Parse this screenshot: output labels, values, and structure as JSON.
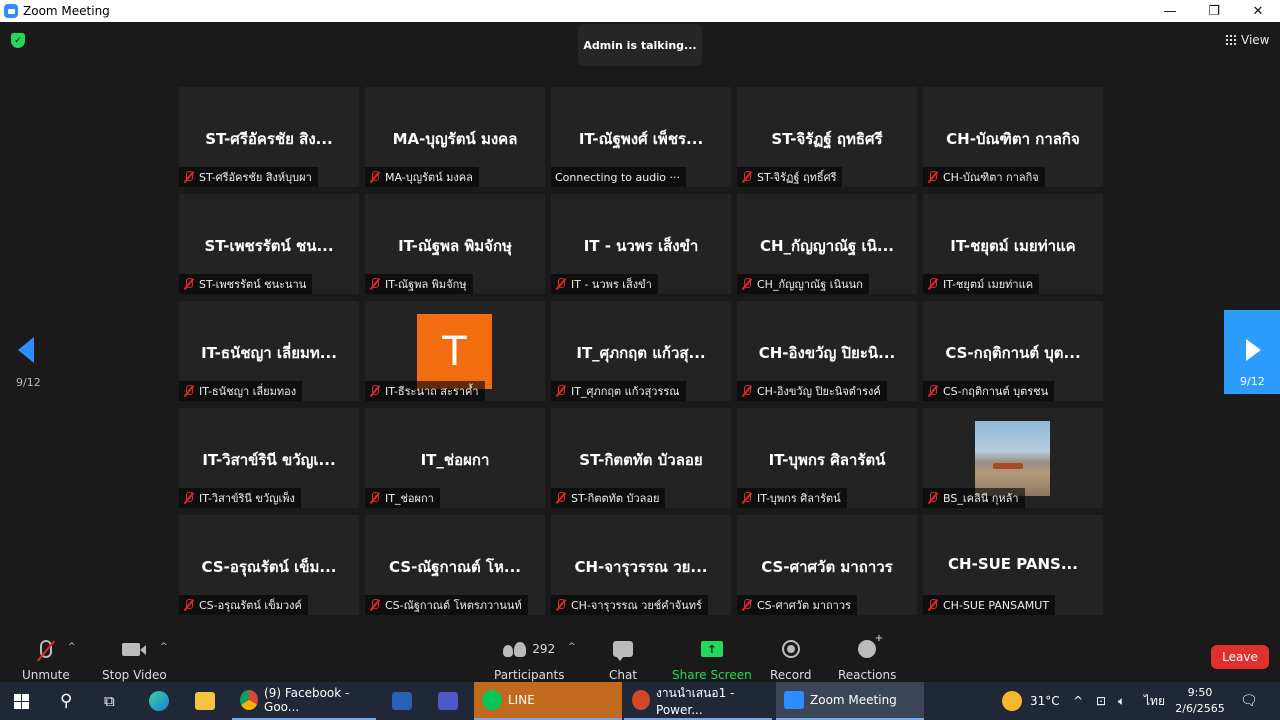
{
  "window": {
    "title": "Zoom Meeting",
    "controls": {
      "minimize": "—",
      "restore": "❐",
      "close": "✕"
    }
  },
  "meeting": {
    "talking_indicator": "Admin is talking...",
    "view_label": "View",
    "page_left": "9/12",
    "page_right": "9/12"
  },
  "tiles": [
    {
      "big": "ST-ศรีอัครชัย สิง...",
      "label": "ST-ศรีอัครชัย สิงห์บุบผา",
      "muted": true
    },
    {
      "big": "MA-บุญรัตน์ มงคล",
      "label": "MA-บุญรัตน์ มงคล",
      "muted": true
    },
    {
      "big": "IT-ณัฐพงศ์ เพ็ชร...",
      "label": "Connecting to audio ···",
      "muted": false
    },
    {
      "big": "ST-จิรัฏฐ์ ฤทธิศรี",
      "label": "ST-จิรัฏฐ์ ฤทธิ์ศรี",
      "muted": true
    },
    {
      "big": "CH-บัณฑิตา กาลกิจ",
      "label": "CH-บัณฑิตา กาลกิจ",
      "muted": true
    },
    {
      "big": "ST-เพชรรัตน์ ชน...",
      "label": "ST-เพชรรัตน์ ชนะนาน",
      "muted": true
    },
    {
      "big": "IT-ณัฐพล พิมจักษุ",
      "label": "IT-ณัฐพล พิมจักษุ",
      "muted": true
    },
    {
      "big": "IT - นวพร เส็งขำ",
      "label": "IT - นวพร เส็งขำ",
      "muted": true
    },
    {
      "big": "CH_กัญญาณัฐ เนิ...",
      "label": "CH_กัญญาณัฐ เนินนก",
      "muted": true
    },
    {
      "big": "IT-ชยุตม์ เมยท่าแค",
      "label": "IT-ชยุตม์ เมยท่าแค",
      "muted": true
    },
    {
      "big": "IT-ธนัชญา เลี่ยมท...",
      "label": "IT-ธนัชญา เลี่ยมทอง",
      "muted": true
    },
    {
      "big": "",
      "avatar": "T",
      "label": "IT-ธีระนาถ สะราค้ำ",
      "muted": true
    },
    {
      "big": "IT_ศุภกฤต แก้วสุ...",
      "label": "IT_ศุภกฤต แก้วสุวรรณ",
      "muted": true
    },
    {
      "big": "CH-อิงขวัญ ปิยะนิ...",
      "label": "CH-อิงขวัญ ปิยะนิจตำรงค์",
      "muted": true
    },
    {
      "big": "CS-กฤติกานต์ บุต...",
      "label": "CS-กฤติกานต์ บุตรชน",
      "muted": true
    },
    {
      "big": "IT-วิสาข์รินี ขวัญเ...",
      "label": "IT-วิสาข์รินี ขวัญเพ็ง",
      "muted": true
    },
    {
      "big": "IT_ช่อผกา",
      "label": "IT_ช่อผกา",
      "muted": true
    },
    {
      "big": "ST-กิตตทัต บัวลอย",
      "label": "ST-กิตตทัต บัวลอย",
      "muted": true
    },
    {
      "big": "IT-บุพกร ศิลารัตน์",
      "label": "IT-บุพกร ศิลารัตน์",
      "muted": true
    },
    {
      "big": "",
      "photo": true,
      "label": "BS_เคลินี กุหล้า",
      "muted": true
    },
    {
      "big": "CS-อรุณรัตน์ เข็ม...",
      "label": "CS-อรุณรัตน์ เข็มวงค์",
      "muted": true
    },
    {
      "big": "CS-ณัฐกาณต์ โห...",
      "label": "CS-ณัฐกาณต์ โหตรภวานนท์",
      "muted": true
    },
    {
      "big": "CH-จารุวรรณ วย...",
      "label": "CH-จารุวรรณ วยช์คำจันทร์",
      "muted": true
    },
    {
      "big": "CS-ศาศวัต มาถาวร",
      "label": "CS-ศาศวัต มาถาวร",
      "muted": true
    },
    {
      "big": "CH-SUE    PANS...",
      "label": "CH-SUE    PANSAMUT",
      "muted": true
    }
  ],
  "toolbar": {
    "unmute": "Unmute",
    "stop_video": "Stop Video",
    "participants_count": "292",
    "participants": "Participants",
    "chat": "Chat",
    "share_screen": "Share Screen",
    "record": "Record",
    "reactions": "Reactions",
    "leave": "Leave"
  },
  "taskbar": {
    "chrome": "(9) Facebook - Goo...",
    "line": "LINE",
    "powerpoint": "งานนำเสนอ1 - Power...",
    "zoom": "Zoom Meeting",
    "temperature": "31°C",
    "language": "ไทย",
    "time": "9:50",
    "date": "2/6/2565"
  },
  "colors": {
    "zoom_blue": "#2d8cff",
    "share_green": "#23d959",
    "leave_red": "#e0302e",
    "mute_red": "#e02828",
    "avatar_orange": "#f26d0f"
  }
}
